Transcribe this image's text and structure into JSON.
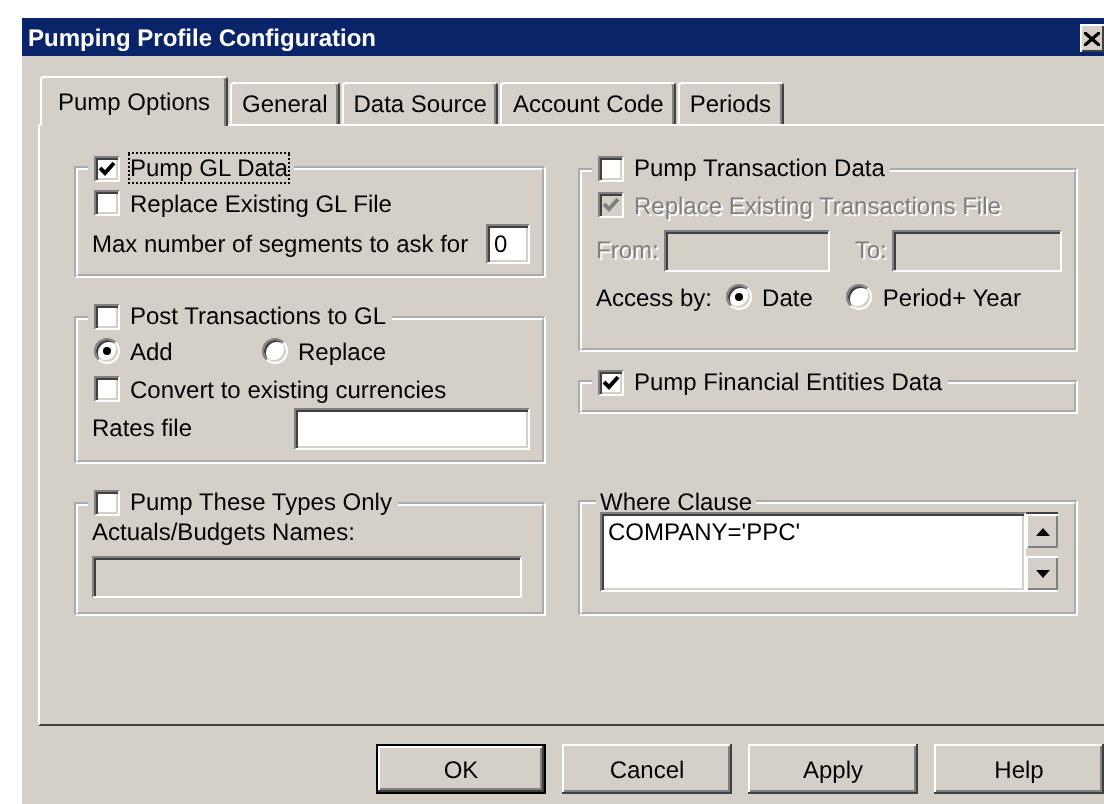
{
  "window": {
    "title": "Pumping Profile Configuration"
  },
  "tabs": [
    {
      "label": "Pump Options",
      "selected": true
    },
    {
      "label": "General",
      "selected": false
    },
    {
      "label": "Data Source",
      "selected": false
    },
    {
      "label": "Account Code",
      "selected": false
    },
    {
      "label": "Periods",
      "selected": false
    }
  ],
  "pump_gl": {
    "label": "Pump GL Data",
    "checked": true,
    "focused": true,
    "replace_existing": {
      "label": "Replace Existing GL File",
      "checked": false
    },
    "max_segments": {
      "label": "Max number of segments to ask for",
      "value": "0"
    }
  },
  "post_transactions": {
    "label": "Post Transactions to GL",
    "checked": false,
    "modes": [
      {
        "label": "Add",
        "selected": true
      },
      {
        "label": "Replace",
        "selected": false
      }
    ],
    "convert": {
      "label": "Convert to existing currencies",
      "checked": false
    },
    "rates_file": {
      "label": "Rates file"
    }
  },
  "pump_types": {
    "label": "Pump These Types Only",
    "checked": false,
    "names_label": "Actuals/Budgets Names:",
    "names_field": {
      "disabled": true
    }
  },
  "pump_transactions": {
    "label": "Pump Transaction Data",
    "checked": false,
    "replace_existing": {
      "label": "Replace Existing Transactions File",
      "checked": true,
      "disabled": true
    },
    "from": {
      "label": "From:",
      "disabled": true
    },
    "to": {
      "label": "To:",
      "disabled": true
    },
    "access_by": {
      "label": "Access by:",
      "options": [
        {
          "label": "Date",
          "selected": true
        },
        {
          "label": "Period+ Year",
          "selected": false
        }
      ]
    }
  },
  "pump_financial": {
    "label": "Pump Financial Entities Data",
    "checked": true
  },
  "where_clause": {
    "label": "Where Clause",
    "value": "COMPANY='PPC'"
  },
  "buttons": [
    {
      "label": "OK",
      "default": true
    },
    {
      "label": "Cancel",
      "default": false
    },
    {
      "label": "Apply",
      "default": false
    },
    {
      "label": "Help",
      "default": false
    }
  ]
}
